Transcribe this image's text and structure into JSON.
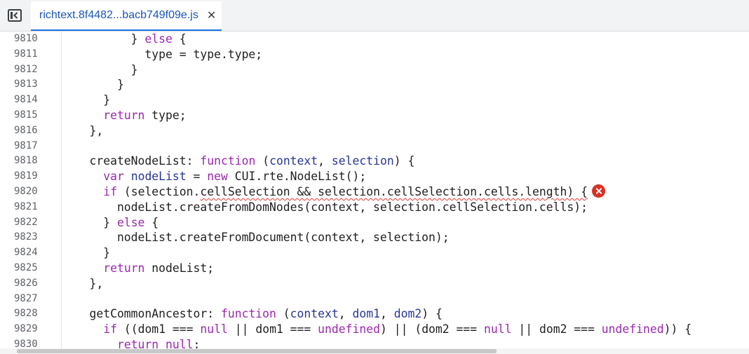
{
  "tab": {
    "label": "richtext.8f4482...bacb749f09e.js",
    "close_label": "✕"
  },
  "colors": {
    "keyword": "#9c27b0",
    "parameter": "#283593",
    "tab_accent": "#1a73e8",
    "error": "#d93025"
  },
  "icons": {
    "sidebar_toggle": "sidebar-toggle-icon",
    "error": "error-icon"
  },
  "code": {
    "line_numbers": [
      "9810",
      "9811",
      "9812",
      "9813",
      "9814",
      "9815",
      "9816",
      "9817",
      "9818",
      "9819",
      "9820",
      "9821",
      "9822",
      "9823",
      "9824",
      "9825",
      "9826",
      "9827",
      "9828",
      "9829",
      "9830"
    ],
    "lines": [
      [
        {
          "t": "          } "
        },
        {
          "t": "else",
          "c": "kw"
        },
        {
          "t": " {"
        }
      ],
      [
        {
          "t": "            type = type.type;"
        }
      ],
      [
        {
          "t": "          }"
        }
      ],
      [
        {
          "t": "        }"
        }
      ],
      [
        {
          "t": "      }"
        }
      ],
      [
        {
          "t": "      "
        },
        {
          "t": "return",
          "c": "kw"
        },
        {
          "t": " type;"
        }
      ],
      [
        {
          "t": "    },"
        }
      ],
      [
        {
          "t": ""
        }
      ],
      [
        {
          "t": "    createNodeList: "
        },
        {
          "t": "function",
          "c": "kw"
        },
        {
          "t": " ("
        },
        {
          "t": "context",
          "c": "param"
        },
        {
          "t": ", "
        },
        {
          "t": "selection",
          "c": "param"
        },
        {
          "t": ") {"
        }
      ],
      [
        {
          "t": "      "
        },
        {
          "t": "var",
          "c": "kw"
        },
        {
          "t": " "
        },
        {
          "t": "nodeList",
          "c": "param"
        },
        {
          "t": " = "
        },
        {
          "t": "new",
          "c": "kw"
        },
        {
          "t": " CUI.rte.NodeList();"
        }
      ],
      [
        {
          "t": "      "
        },
        {
          "t": "if",
          "c": "kw"
        },
        {
          "t": " (selection."
        },
        {
          "t": "cellSelection && selection.cellSelection.cells.length) {",
          "c": "squiggle"
        },
        {
          "err": true
        }
      ],
      [
        {
          "t": "        nodeList.createFromDomNodes(context, selection.cellSelection.cells);"
        }
      ],
      [
        {
          "t": "      } "
        },
        {
          "t": "else",
          "c": "kw"
        },
        {
          "t": " {"
        }
      ],
      [
        {
          "t": "        nodeList.createFromDocument(context, selection);"
        }
      ],
      [
        {
          "t": "      }"
        }
      ],
      [
        {
          "t": "      "
        },
        {
          "t": "return",
          "c": "kw"
        },
        {
          "t": " nodeList;"
        }
      ],
      [
        {
          "t": "    },"
        }
      ],
      [
        {
          "t": ""
        }
      ],
      [
        {
          "t": "    getCommonAncestor: "
        },
        {
          "t": "function",
          "c": "kw"
        },
        {
          "t": " ("
        },
        {
          "t": "context",
          "c": "param"
        },
        {
          "t": ", "
        },
        {
          "t": "dom1",
          "c": "param"
        },
        {
          "t": ", "
        },
        {
          "t": "dom2",
          "c": "param"
        },
        {
          "t": ") {"
        }
      ],
      [
        {
          "t": "      "
        },
        {
          "t": "if",
          "c": "kw"
        },
        {
          "t": " ((dom1 === "
        },
        {
          "t": "null",
          "c": "kw"
        },
        {
          "t": " || dom1 === "
        },
        {
          "t": "undefined",
          "c": "kw"
        },
        {
          "t": ") || (dom2 === "
        },
        {
          "t": "null",
          "c": "kw"
        },
        {
          "t": " || dom2 === "
        },
        {
          "t": "undefined",
          "c": "kw"
        },
        {
          "t": ")) {"
        }
      ],
      [
        {
          "t": "        "
        },
        {
          "t": "return",
          "c": "kw"
        },
        {
          "t": " "
        },
        {
          "t": "null",
          "c": "kw"
        },
        {
          "t": ";"
        }
      ]
    ]
  }
}
